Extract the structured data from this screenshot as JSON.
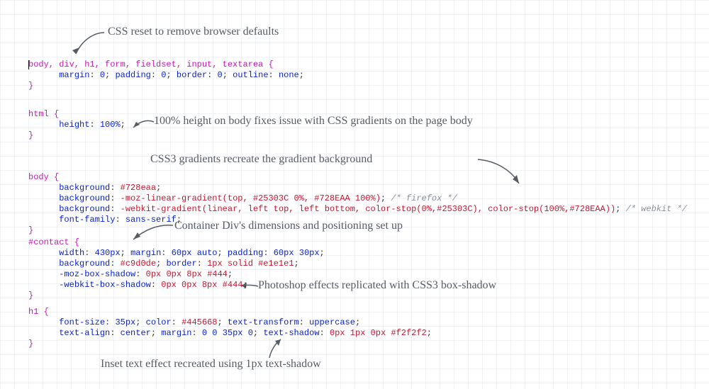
{
  "annotations": {
    "a1": "CSS reset to remove browser defaults",
    "a2": "100% height on body fixes issue with CSS gradients on the page body",
    "a3": "CSS3 gradients recreate the gradient background",
    "a4": "Container Div's dimensions and positioning set up",
    "a5": "Photoshop effects replicated with CSS3 box-shadow",
    "a6": "Inset text effect recreated using 1px text-shadow"
  },
  "code": {
    "reset": {
      "selector": "body, div, h1, form, fieldset, input, textarea",
      "props": {
        "margin_k": "margin",
        "margin_v": "0",
        "padding_k": "padding",
        "padding_v": "0",
        "border_k": "border",
        "border_v": "0",
        "outline_k": "outline",
        "outline_v": "none"
      }
    },
    "html": {
      "selector": "html",
      "props": {
        "height_k": "height",
        "height_v": "100%"
      }
    },
    "body": {
      "selector": "body",
      "props": {
        "bg_k": "background",
        "bg_v": "#728eaa",
        "moz_k": "background",
        "moz_v": "-moz-linear-gradient(top, #25303C 0%, #728EAA 100%)",
        "moz_c": "/* firefox */",
        "wk_k": "background",
        "wk_v": "-webkit-gradient(linear, left top, left bottom, color-stop(0%,#25303C), color-stop(100%,#728EAA))",
        "wk_c": "/* webkit */",
        "ff_k": "font-family",
        "ff_v": "sans-serif"
      }
    },
    "contact": {
      "selector": "#contact",
      "props": {
        "width_k": "width",
        "width_v": "430px",
        "margin_k": "margin",
        "margin_v": "60px auto",
        "padding_k": "padding",
        "padding_v": "60px 30px",
        "bg_k": "background",
        "bg_v": "#c9d0de",
        "border_k": "border",
        "border_v": "1px solid #e1e1e1",
        "mozshadow_k": "-moz-box-shadow",
        "mozshadow_v": "0px 0px 8px #444",
        "wkshadow_k": "-webkit-box-shadow",
        "wkshadow_v": "0px 0px 8px #444"
      }
    },
    "h1": {
      "selector": "h1",
      "props": {
        "fs_k": "font-size",
        "fs_v": "35px",
        "color_k": "color",
        "color_v": "#445668",
        "tt_k": "text-transform",
        "tt_v": "uppercase",
        "ta_k": "text-align",
        "ta_v": "center",
        "margin_k": "margin",
        "margin_v": "0 0 35px 0",
        "ts_k": "text-shadow",
        "ts_v": "0px 1px 0px #f2f2f2"
      }
    }
  }
}
